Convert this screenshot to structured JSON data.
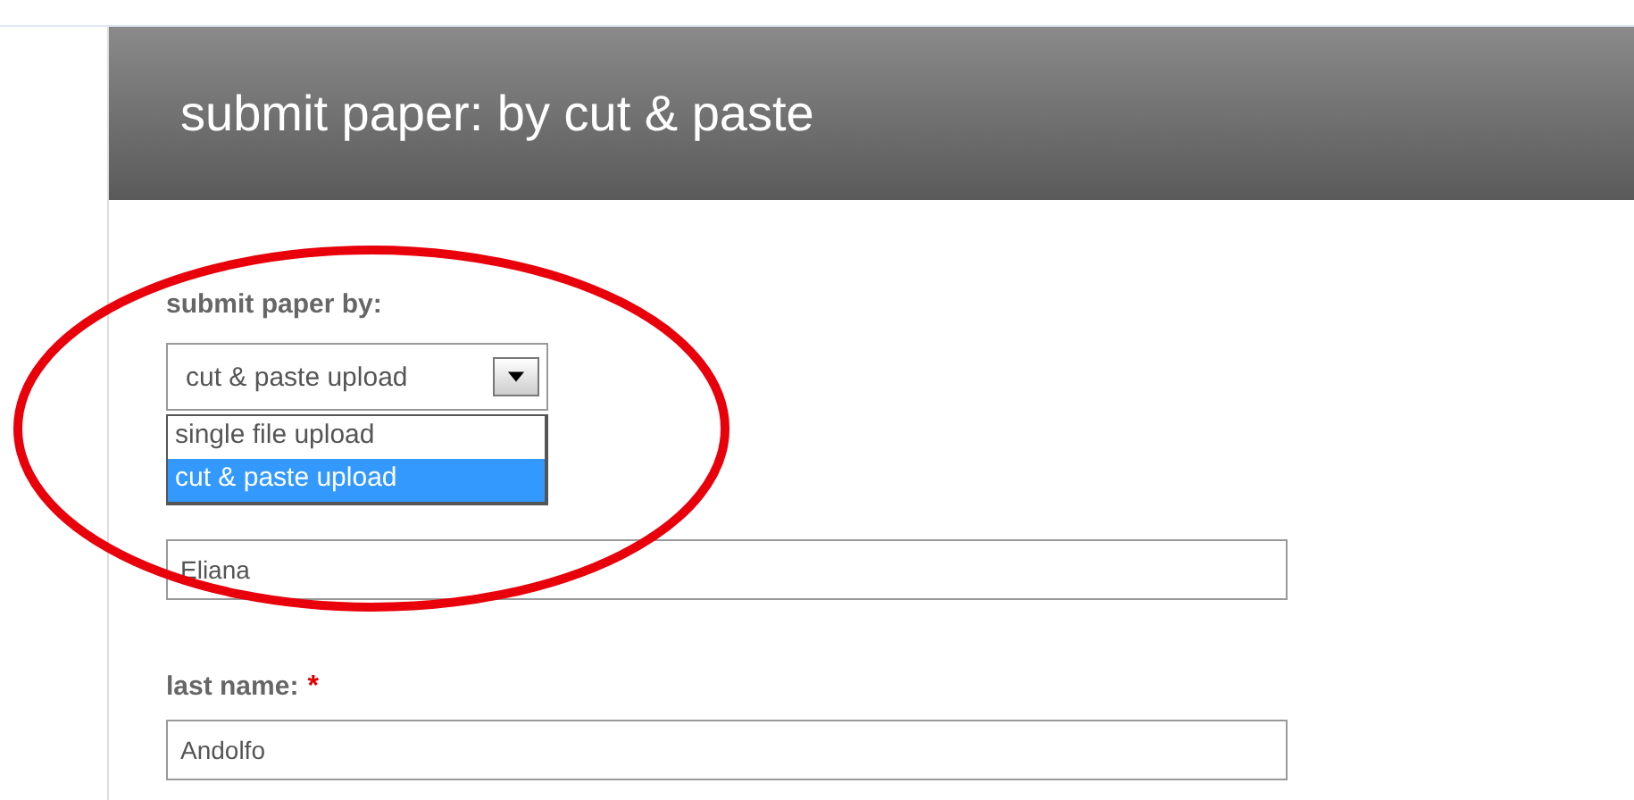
{
  "header": {
    "title": "submit paper: by cut & paste"
  },
  "submit_by": {
    "label": "submit paper by:",
    "value": "cut & paste upload",
    "options": [
      {
        "label": "single file upload",
        "selected": false
      },
      {
        "label": "cut & paste upload",
        "selected": true
      }
    ]
  },
  "fields": [
    {
      "value": "Eliana"
    },
    {
      "label": "last name:",
      "required_mark": "*",
      "value": "Andolfo"
    }
  ],
  "highlight": {
    "kind": "ellipse"
  }
}
